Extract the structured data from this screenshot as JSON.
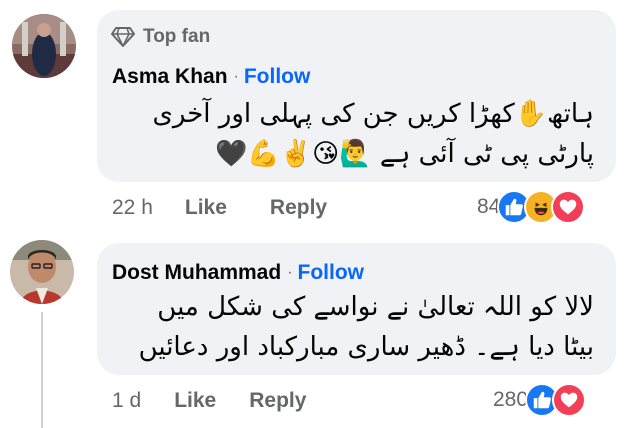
{
  "comments": [
    {
      "badge": "Top fan",
      "author": "Asma Khan",
      "follow": "Follow",
      "separator": "·",
      "lines": [
        "ہاتھ✋کھڑا کریں جن کی پہلی اور آخری",
        "پارٹی پی ٹی آئی ہے 🙋‍♂️😘✌️💪🖤"
      ],
      "time": "22 h",
      "like": "Like",
      "reply": "Reply",
      "reaction_count": "84",
      "reactions": [
        "like",
        "haha",
        "love"
      ]
    },
    {
      "author": "Dost Muhammad",
      "follow": "Follow",
      "separator": "·",
      "lines": [
        "لالا کو اللہ تعالیٰ نے نواسے کی شکل میں",
        "بیٹا دیا ہے۔ ڈھیر ساری مبارکباد اور دعائیں"
      ],
      "time": "1 d",
      "like": "Like",
      "reply": "Reply",
      "reaction_count": "280",
      "reactions": [
        "like",
        "love"
      ]
    }
  ],
  "colors": {
    "bubble": "#f0f2f5",
    "follow": "#0866ff",
    "meta": "#65676b",
    "like": "#1877f2",
    "haha": "#f7b125",
    "love": "#f33e58"
  }
}
